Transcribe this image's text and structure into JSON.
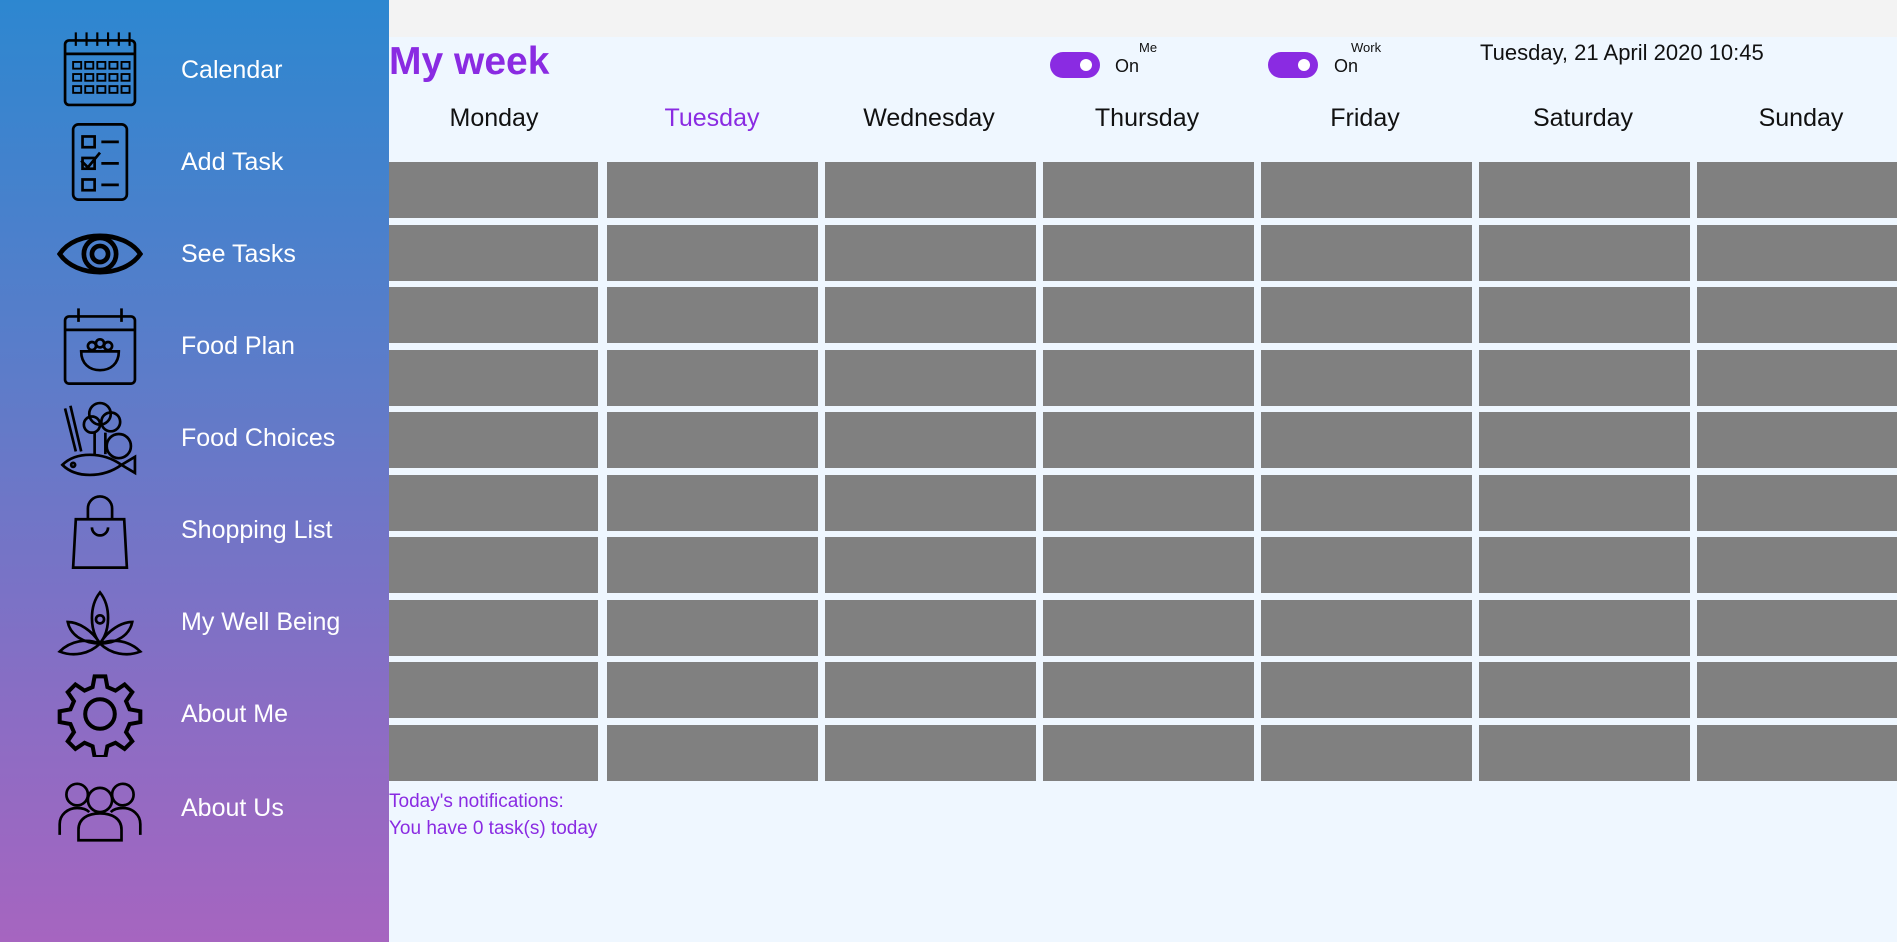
{
  "sidebar": {
    "items": [
      {
        "label": "Calendar",
        "icon": "calendar-icon"
      },
      {
        "label": "Add Task",
        "icon": "checklist-icon"
      },
      {
        "label": "See Tasks",
        "icon": "eye-icon"
      },
      {
        "label": "Food Plan",
        "icon": "food-bowl-calendar-icon"
      },
      {
        "label": "Food Choices",
        "icon": "vegetables-fish-icon"
      },
      {
        "label": "Shopping List",
        "icon": "shopping-bag-icon"
      },
      {
        "label": "My Well Being",
        "icon": "lotus-icon"
      },
      {
        "label": "About Me",
        "icon": "gear-icon"
      },
      {
        "label": "About Us",
        "icon": "group-icon"
      }
    ]
  },
  "header": {
    "title": "My week",
    "datetime": "Tuesday, 21 April 2020 10:45"
  },
  "toggles": [
    {
      "header": "Me",
      "state": "On",
      "checked": true
    },
    {
      "header": "Work",
      "state": "On",
      "checked": true
    }
  ],
  "week": {
    "days": [
      "Monday",
      "Tuesday",
      "Wednesday",
      "Thursday",
      "Friday",
      "Saturday",
      "Sunday"
    ],
    "active_day": "Tuesday",
    "rows": 10
  },
  "notifications": {
    "heading": "Today's notifications:",
    "message": "You have 0 task(s) today"
  },
  "colors": {
    "accent": "#8a2be2",
    "cell": "#808080",
    "background": "#eff7ff",
    "sidebar_top": "#2d87d0",
    "sidebar_bottom": "#a665c0"
  }
}
